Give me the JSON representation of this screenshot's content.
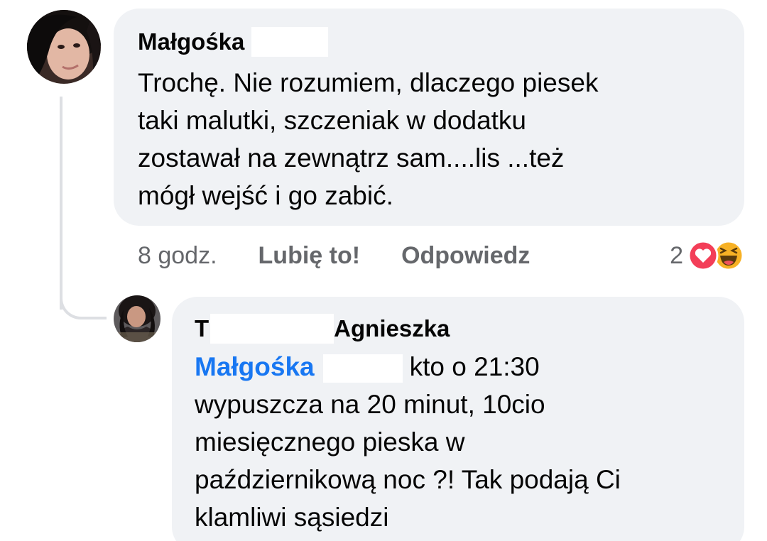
{
  "comment": {
    "author": "Małgośka",
    "text": "Trochę. Nie rozumiem, dlaczego piesek\ntaki malutki, szczeniak w dodatku\nzostawał na zewnątrz sam....lis ...też\nmógł wejść i go zabić.",
    "time": "8 godz.",
    "like_label": "Lubię to!",
    "reply_label": "Odpowiedz",
    "reaction_count": "2",
    "reactions": [
      "heart-icon",
      "haha-icon"
    ]
  },
  "reply": {
    "author_first": "T",
    "author_last": "Agnieszka",
    "mention": "Małgośka",
    "text": "kto o 21:30\nwypuszcza na 20 minut, 10cio\nmiesięcznego pieska w\npaździernikową noc ?! Tak podają Ci\nklamliwi sąsiedzi"
  },
  "colors": {
    "bubble": "#f0f2f5",
    "mention": "#1877f2",
    "meta": "#65676b",
    "heart": "#f33e58",
    "haha": "#f7b125"
  }
}
